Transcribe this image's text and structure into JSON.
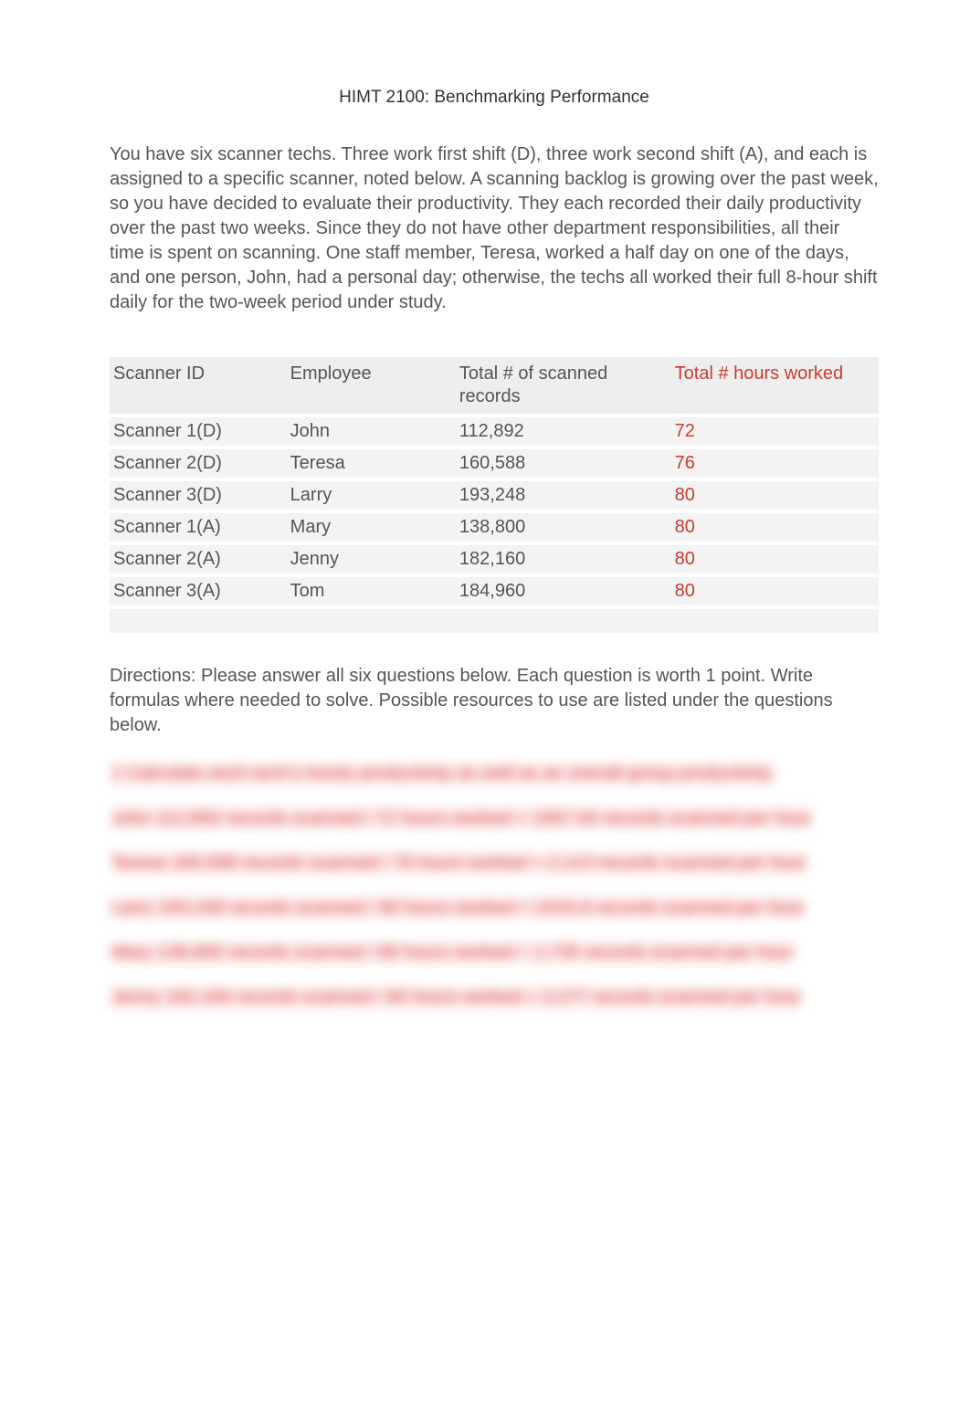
{
  "title": "HIMT 2100: Benchmarking Performance",
  "intro": "You have six scanner techs. Three work first shift (D), three work second shift (A), and each is assigned to a specific scanner, noted below. A scanning backlog is growing over the past week, so you have decided to evaluate their productivity. They each recorded their daily productivity over the past two weeks. Since they do not have other department responsibilities, all their time is spent on scanning. One staff member, Teresa, worked a half day on one of the days, and one person, John, had a personal day; otherwise, the techs all worked their full 8-hour shift daily for the two-week period under study.",
  "table": {
    "headers": {
      "scanner": "Scanner ID",
      "employee": "Employee",
      "records": "Total # of scanned records",
      "hours": "Total # hours worked"
    },
    "rows": [
      {
        "scanner": "Scanner 1(D)",
        "employee": "John",
        "records": "112,892",
        "hours": "72"
      },
      {
        "scanner": "Scanner 2(D)",
        "employee": "Teresa",
        "records": "160,588",
        "hours": "76"
      },
      {
        "scanner": "Scanner 3(D)",
        "employee": "Larry",
        "records": "193,248",
        "hours": "80"
      },
      {
        "scanner": "Scanner 1(A)",
        "employee": "Mary",
        "records": "138,800",
        "hours": "80"
      },
      {
        "scanner": "Scanner 2(A)",
        "employee": "Jenny",
        "records": "182,160",
        "hours": "80"
      },
      {
        "scanner": "Scanner 3(A)",
        "employee": "Tom",
        "records": "184,960",
        "hours": "80"
      }
    ]
  },
  "directions": "Directions: Please answer all six questions below. Each question is worth 1 point. Write formulas where needed to solve. Possible resources to use are listed under the questions below.",
  "obscured": {
    "q1": "1 Calculate each tech’s hourly productivity as well as an overall group productivity.",
    "a1": "John  112,892 records scanned / 72 hours worked = 1567.94 records scanned per hour",
    "a2": "Teresa  160,588 records scanned / 76 hours worked = 2,113 records scanned per hour",
    "a3": "Larry    193,248 records scanned / 80 hours worked = 2415.6 records scanned per hour",
    "a4": "Mary   138,800 records scanned / 80 hours worked = 1,735 records scanned per hour",
    "a5": "Jenny  182,160 records scanned / 80 hours worked = 2,277 records scanned per hour"
  }
}
